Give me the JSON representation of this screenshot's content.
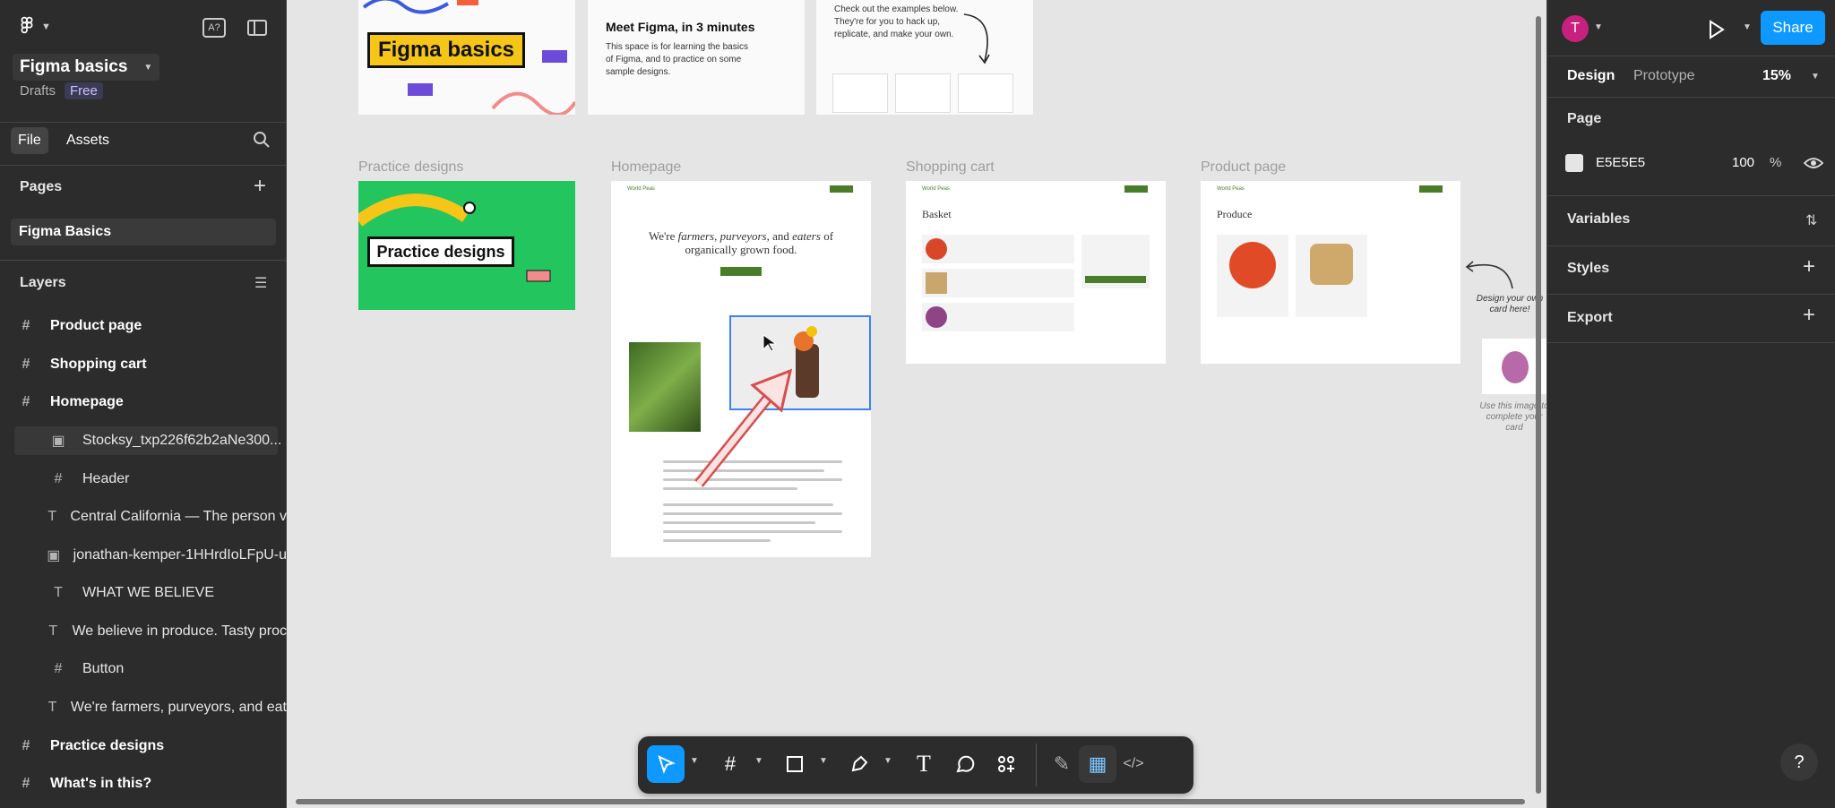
{
  "file": {
    "name": "Figma basics",
    "location": "Drafts",
    "plan": "Free"
  },
  "left_tabs": {
    "file": "File",
    "assets": "Assets"
  },
  "pages": {
    "title": "Pages",
    "items": [
      "Figma Basics"
    ]
  },
  "layers": {
    "title": "Layers",
    "items": [
      {
        "label": "Product page",
        "kind": "frame"
      },
      {
        "label": "Shopping cart",
        "kind": "frame"
      },
      {
        "label": "Homepage",
        "kind": "frame"
      },
      {
        "label": "Stocksy_txp226f62b2aNe300...",
        "kind": "image"
      },
      {
        "label": "Header",
        "kind": "frame"
      },
      {
        "label": "Central California — The person v",
        "kind": "text"
      },
      {
        "label": "jonathan-kemper-1HHrdIoLFpU-u",
        "kind": "image"
      },
      {
        "label": "WHAT WE BELIEVE",
        "kind": "text"
      },
      {
        "label": "We believe in produce. Tasty proc",
        "kind": "text"
      },
      {
        "label": "Button",
        "kind": "frame"
      },
      {
        "label": "We're farmers, purveyors, and eat",
        "kind": "text"
      },
      {
        "label": "Practice designs",
        "kind": "frame"
      },
      {
        "label": "What's in this?",
        "kind": "frame"
      }
    ]
  },
  "canvas": {
    "top_cards": {
      "figma_basics_sticker": "Figma basics",
      "meet_title": "Meet Figma, in 3 minutes",
      "meet_body": "This space is for learning the basics of Figma, and to practice on some sample designs.",
      "examples_body": "Check out the examples below. They're for you to hack up, replicate, and make your own."
    },
    "frames": {
      "practice": {
        "label": "Practice designs",
        "sticker": "Practice designs"
      },
      "homepage": {
        "label": "Homepage",
        "brand": "World Peas",
        "headline_a": "We're ",
        "headline_b": "farmers",
        "headline_c": ", ",
        "headline_d": "purveyors",
        "headline_e": ", and ",
        "headline_f": "eaters",
        "headline_g": " of organically grown food."
      },
      "cart": {
        "label": "Shopping cart",
        "brand": "World Peas",
        "title": "Basket"
      },
      "product": {
        "label": "Product page",
        "brand": "World Peas",
        "title": "Produce"
      }
    },
    "note_design": "Design your own card here!",
    "note_use": "Use this image to complete your card"
  },
  "toolbar": {
    "tools": [
      "move",
      "frame",
      "shape",
      "pen",
      "text",
      "comment",
      "actions",
      "draw",
      "dev-mode",
      "code"
    ]
  },
  "right": {
    "avatar_letter": "T",
    "share": "Share",
    "tabs": {
      "design": "Design",
      "prototype": "Prototype"
    },
    "zoom": "15%",
    "page_section": "Page",
    "page_color": "E5E5E5",
    "page_opacity": "100",
    "percent": "%",
    "variables": "Variables",
    "styles": "Styles",
    "export": "Export",
    "help": "?"
  },
  "colors": {
    "accent": "#0d99ff",
    "panel": "#2c2c2c",
    "canvas": "#e5e5e5",
    "avatar": "#c7217f",
    "green": "#22c55e"
  }
}
